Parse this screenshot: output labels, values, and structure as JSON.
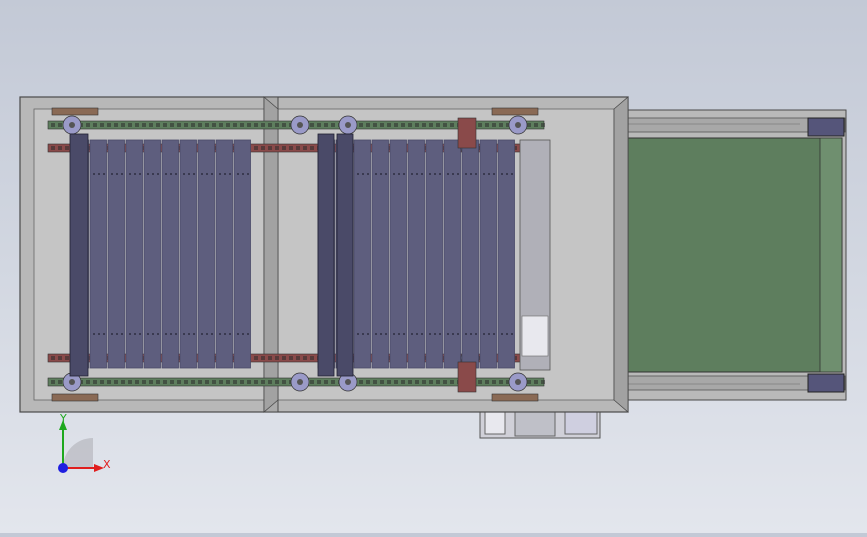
{
  "triad": {
    "x_label": "X",
    "y_label": "Y"
  },
  "colors": {
    "background_top": "#c3c9d6",
    "background_bottom": "#e3e6ed",
    "frame": "#b8b8b8",
    "frame_edge": "#4a4a4a",
    "slat": "#5e5e7e",
    "slat_dark": "#4a4a68",
    "belt": "#5e7e5e",
    "chain_red": "#8a4a4a",
    "chain_green": "#5e7e5e",
    "axis_x": "#e01e1e",
    "axis_y": "#1ea81e",
    "axis_z": "#1e1ee0"
  },
  "icons": [
    "coordinate-triad-icon"
  ]
}
